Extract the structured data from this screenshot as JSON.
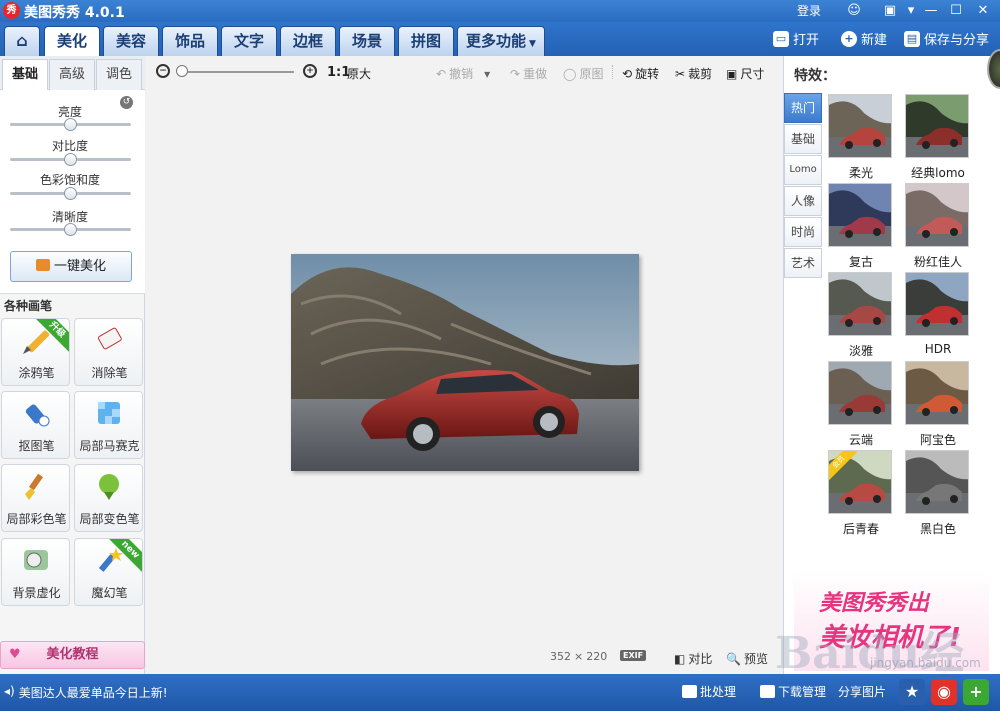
{
  "titlebar": {
    "title": "美图秀秀 4.0.1",
    "login": "登录",
    "logo_glyph": "秀"
  },
  "menu": {
    "tabs": [
      "美化",
      "美容",
      "饰品",
      "文字",
      "边框",
      "场景",
      "拼图",
      "更多功能"
    ],
    "active": "美化",
    "actions": [
      "打开",
      "新建",
      "保存与分享"
    ]
  },
  "left": {
    "subtabs": [
      "基础",
      "高级",
      "调色"
    ],
    "sliders": [
      {
        "label": "亮度",
        "value": 0.5
      },
      {
        "label": "对比度",
        "value": 0.5
      },
      {
        "label": "色彩饱和度",
        "value": 0.5
      },
      {
        "label": "清晰度",
        "value": 0.5
      }
    ],
    "one_key": "一键美化",
    "brush_title": "各种画笔",
    "brushes": [
      {
        "label": "涂鸦笔",
        "badge": "升级"
      },
      {
        "label": "消除笔",
        "badge": ""
      },
      {
        "label": "抠图笔",
        "badge": ""
      },
      {
        "label": "局部马赛克",
        "badge": ""
      },
      {
        "label": "局部彩色笔",
        "badge": ""
      },
      {
        "label": "局部变色笔",
        "badge": ""
      },
      {
        "label": "背景虚化",
        "badge": ""
      },
      {
        "label": "魔幻笔",
        "badge": "new"
      }
    ],
    "tutorial": "美化教程"
  },
  "toolbar": {
    "ratio": "1:1",
    "original_size": "原大",
    "undo": "撤销",
    "redo": "重做",
    "original": "原图",
    "rotate": "旋转",
    "crop": "裁剪",
    "size": "尺寸",
    "zoom": 0.0
  },
  "canvas": {
    "width": "352",
    "times": "×",
    "height": "220",
    "exif": "EXIF",
    "compare": "对比",
    "preview": "预览"
  },
  "effects": {
    "title": "特效：",
    "categories": [
      "热门",
      "基础",
      "Lomo",
      "人像",
      "时尚",
      "艺术"
    ],
    "active": "热门",
    "items": [
      "柔光",
      "经典lomo",
      "复古",
      "粉红佳人",
      "淡雅",
      "HDR",
      "云端",
      "阿宝色",
      "后青春",
      "黑白色"
    ],
    "badge_item": "后青春",
    "badge_text": "会员",
    "promo_line1": "美图秀秀出",
    "promo_line2": "美妆相机了!"
  },
  "bottom": {
    "news": "美图达人最爱单品今日上新!",
    "actions": [
      "批处理",
      "下载管理",
      "分享图片"
    ]
  },
  "watermark": {
    "text": "Baidu经验",
    "url": "jingyan.baidu.com"
  },
  "colors": {
    "titlebar": "#2a6cc0",
    "accent": "#e8337f"
  }
}
